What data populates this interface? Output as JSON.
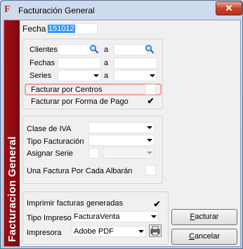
{
  "window": {
    "title": "Facturación General",
    "close_glyph": "✕"
  },
  "sidebar": {
    "label": "Facturacion General"
  },
  "fecha": {
    "label": "Fecha",
    "value": "151012"
  },
  "filters": {
    "clientes_label": "Clientes",
    "fechas_label": "Fechas",
    "series_label": "Series",
    "a_label": "a",
    "facturar_centros_label": "Facturar por Centros",
    "facturar_centros_checked": "",
    "facturar_forma_pago_label": "Facturar por Forma de Pago",
    "facturar_forma_pago_checked": "✔"
  },
  "options": {
    "clase_iva_label": "Clase de IVA",
    "tipo_facturacion_label": "Tipo Facturación",
    "asignar_serie_label": "Asignar Serie",
    "una_factura_label": "Una Factura Por Cada Albarán"
  },
  "print": {
    "imprimir_label": "Imprimir facturas generadas",
    "imprimir_checked": "✔",
    "tipo_impreso_label": "Tipo Impreso",
    "tipo_impreso_value": "FacturaVenta",
    "impresora_label": "Impresora",
    "impresora_value": "Adobe PDF"
  },
  "buttons": {
    "facturar_pre": "",
    "facturar_ul": "F",
    "facturar_post": "acturar",
    "cancelar_pre": "",
    "cancelar_ul": "C",
    "cancelar_post": "ancelar"
  },
  "icons": {
    "app": "F",
    "search": "search-icon",
    "printer": "printer-icon"
  }
}
